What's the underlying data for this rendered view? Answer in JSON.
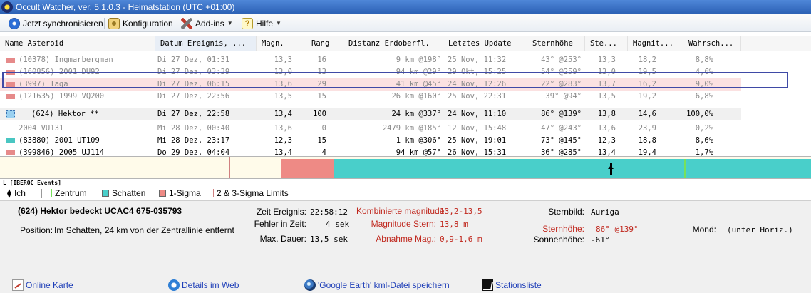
{
  "window": {
    "title": "Occult Watcher, ver. 5.1.0.3 - Heimatstation (UTC +01:00)"
  },
  "toolbar": {
    "sync_label": "Jetzt synchronisieren",
    "config_label": "Konfiguration",
    "addins_label": "Add-ins",
    "help_label": "Hilfe"
  },
  "table": {
    "headers": [
      "Name Asteroid",
      "Datum Ereignis, ...",
      "Magn.",
      "Rang",
      "Distanz Erdoberfl.",
      "Letztes Update",
      "Sternhöhe",
      "Ste...",
      "Magnit...",
      "Wahrsch..."
    ],
    "rows": [
      {
        "name": "(10378) Ingmarbergman",
        "date": "Di 27 Dez, 01:31",
        "magn": "13,3",
        "rank": "16",
        "dist": "9 km @198°",
        "update": "25 Nov, 11:32",
        "alt": "43° @253°",
        "ste": "13,3",
        "magnit": "18,2",
        "prob": "8,8%",
        "swatch": "#e68a8a"
      },
      {
        "name": "(160856) 2001 DU92",
        "date": "Di 27 Dez, 03:39",
        "magn": "13,0",
        "rank": "13",
        "dist": "94 km @29°",
        "update": "29 Okt, 15:25",
        "alt": "54° @259°",
        "ste": "13,0",
        "magnit": "19,5",
        "prob": "4,6%",
        "swatch": "#e68a8a"
      },
      {
        "name": "(3997) Taga",
        "date": "Di 27 Dez, 06:15",
        "magn": "13,6",
        "rank": "29",
        "dist": "41 km @45°",
        "update": "24 Nov, 12:26",
        "alt": "22° @283°",
        "ste": "13,7",
        "magnit": "16,2",
        "prob": "9,0%",
        "swatch": "#e68a8a"
      },
      {
        "name": "(121635) 1999 VQ200",
        "date": "Di 27 Dez, 22:56",
        "magn": "13,5",
        "rank": "15",
        "dist": "26 km @160°",
        "update": "25 Nov, 22:31",
        "alt": "39° @94°",
        "ste": "13,5",
        "magnit": "19,2",
        "prob": "6,8%",
        "swatch": "#e68a8a"
      },
      {
        "name": "(624) Hektor **",
        "date": "Di 27 Dez, 22:58",
        "magn": "13,4",
        "rank": "100",
        "dist": "24 km @337°",
        "update": "24 Nov, 11:10",
        "alt": "86° @139°",
        "ste": "13,8",
        "magnit": "14,6",
        "prob": "100,0%",
        "swatch": "#9ad0f0"
      },
      {
        "name": "2004 VU131",
        "date": "Mi 28 Dez, 00:40",
        "magn": "13,6",
        "rank": "0",
        "dist": "2479 km @185°",
        "update": "12 Nov, 15:48",
        "alt": "47° @243°",
        "ste": "13,6",
        "magnit": "23,9",
        "prob": "0,2%",
        "swatch": ""
      },
      {
        "name": "(83880) 2001 UT109",
        "date": "Mi 28 Dez, 23:17",
        "magn": "12,3",
        "rank": "15",
        "dist": "1 km @306°",
        "update": "25 Nov, 19:01",
        "alt": "73° @145°",
        "ste": "12,3",
        "magnit": "18,8",
        "prob": "8,6%",
        "swatch": "#49c6c2"
      },
      {
        "name": "(399846) 2005 UJ114",
        "date": "Do 29 Dez, 04:04",
        "magn": "13,4",
        "rank": "4",
        "dist": "94 km @57°",
        "update": "26 Nov, 15:31",
        "alt": "36° @285°",
        "ste": "13,4",
        "magnit": "19,4",
        "prob": "1,7%",
        "swatch": "#e68a8a"
      }
    ]
  },
  "timeline": {
    "caption": "L [IBEROC Events]"
  },
  "legend": {
    "me": "Ich",
    "center": "Zentrum",
    "shadow": "Schatten",
    "sigma1": "1-Sigma",
    "limits": "2 & 3-Sigma Limits",
    "colors": {
      "shadow": "#49cfca",
      "sigma1": "#ee8a85",
      "center": "#77e15a"
    }
  },
  "details": {
    "title": "(624) Hektor bedeckt  UCAC4 675-035793",
    "position_label": "Position:",
    "position_value": "Im Schatten, 24 km von der Zentrallinie entfernt",
    "event_time_label": "Zeit Ereignis:",
    "event_time_value": "22:58:12",
    "time_error_label": "Fehler in Zeit:",
    "time_error_value": "4 sek",
    "max_duration_label": "Max. Dauer:",
    "max_duration_value": "13,5 sek",
    "combined_mag_label": "Kombinierte magnitude:",
    "combined_mag_value": "13,2-13,5",
    "star_mag_label": "Magnitude Stern:",
    "star_mag_value": "13,8 m",
    "mag_drop_label": "Abnahme Mag.:",
    "mag_drop_value": "0,9-1,6 m",
    "constellation_label": "Sternbild:",
    "constellation_value": "Auriga",
    "star_alt_label": "Sternhöhe:",
    "star_alt_value": "86° @139°",
    "sun_alt_label": "Sonnenhöhe:",
    "sun_alt_value": "-61°",
    "moon_label": "Mond:",
    "moon_value": "(unter Horiz.)"
  },
  "links": {
    "online_map": "Online Karte",
    "web_details": "Details im Web",
    "kml": "'Google Earth' kml-Datei speichern",
    "stations": "Stationsliste"
  }
}
